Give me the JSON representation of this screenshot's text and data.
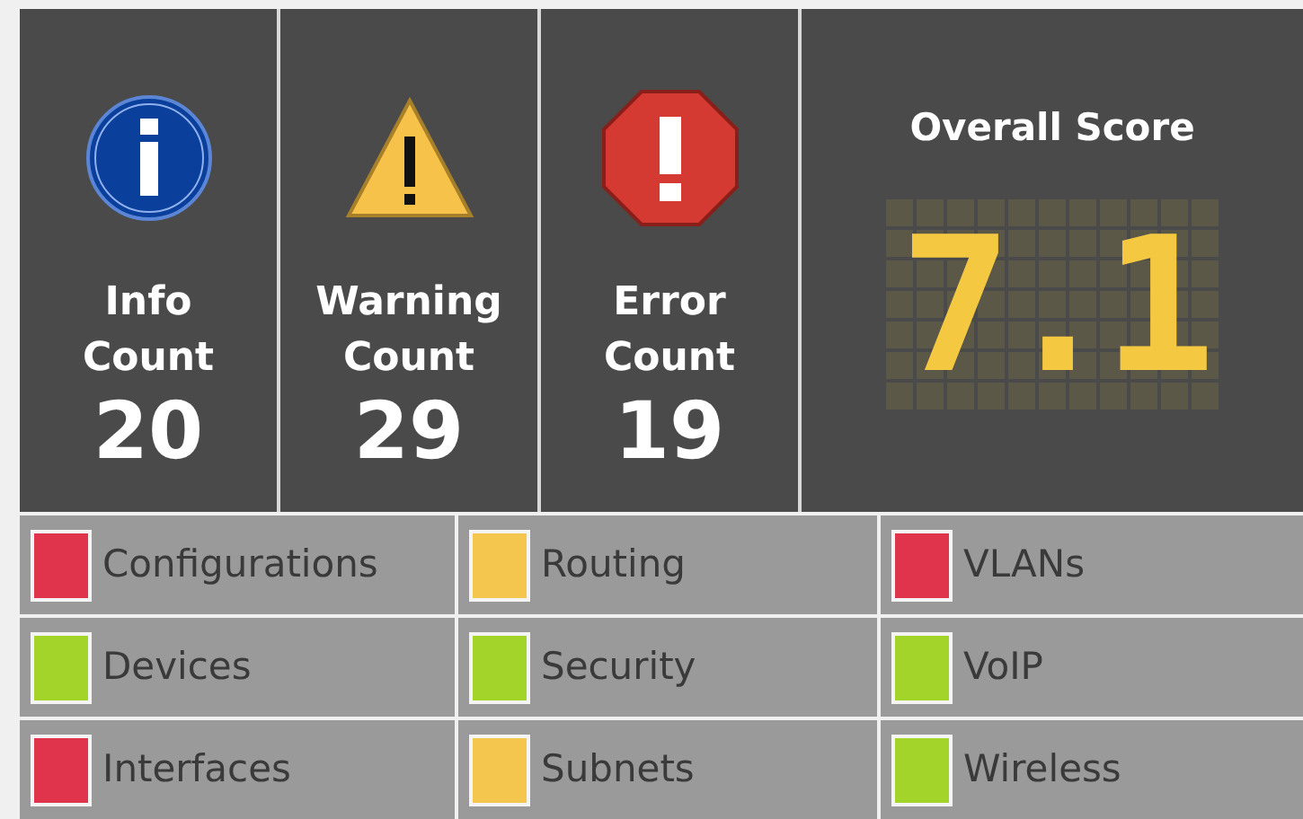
{
  "counters": [
    {
      "kind": "info",
      "label": "Info Count",
      "count": "20"
    },
    {
      "kind": "warning",
      "label": "Warning Count",
      "count": "29"
    },
    {
      "kind": "error",
      "label": "Error Count",
      "count": "19"
    }
  ],
  "score": {
    "title": "Overall Score",
    "value": "7.1"
  },
  "categories": [
    {
      "name": "Configurations",
      "color": "#e0344c"
    },
    {
      "name": "Routing",
      "color": "#f5c64e"
    },
    {
      "name": "VLANs",
      "color": "#e0344c"
    },
    {
      "name": "Devices",
      "color": "#a3d42a"
    },
    {
      "name": "Security",
      "color": "#a3d42a"
    },
    {
      "name": "VoIP",
      "color": "#a3d42a"
    },
    {
      "name": "Interfaces",
      "color": "#e0344c"
    },
    {
      "name": "Subnets",
      "color": "#f5c64e"
    },
    {
      "name": "Wireless",
      "color": "#a3d42a"
    }
  ]
}
